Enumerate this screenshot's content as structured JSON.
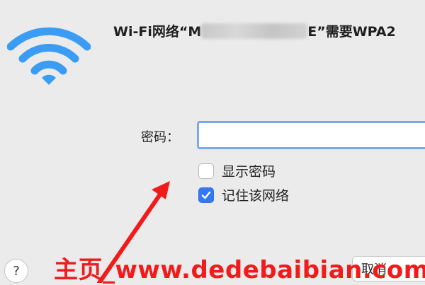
{
  "dialog": {
    "title_prefix": "Wi-Fi网络“M",
    "title_suffix": "E”需要WPA2",
    "password_label": "密码：",
    "password_value": "",
    "show_password_label": "显示密码",
    "show_password_checked": false,
    "remember_network_label": "记住该网络",
    "remember_network_checked": true,
    "help_label": "?",
    "cancel_label": "取消"
  },
  "overlay": {
    "watermark": "主页_www.dedebaibian.com"
  },
  "colors": {
    "wifi_blue": "#3a9cf2",
    "accent": "#3478f6",
    "focus_ring": "#7da8f0",
    "watermark_red": "#f21b1b"
  },
  "icons": {
    "wifi": "wifi-icon",
    "check": "checkmark-icon",
    "arrow": "red-arrow-icon"
  }
}
